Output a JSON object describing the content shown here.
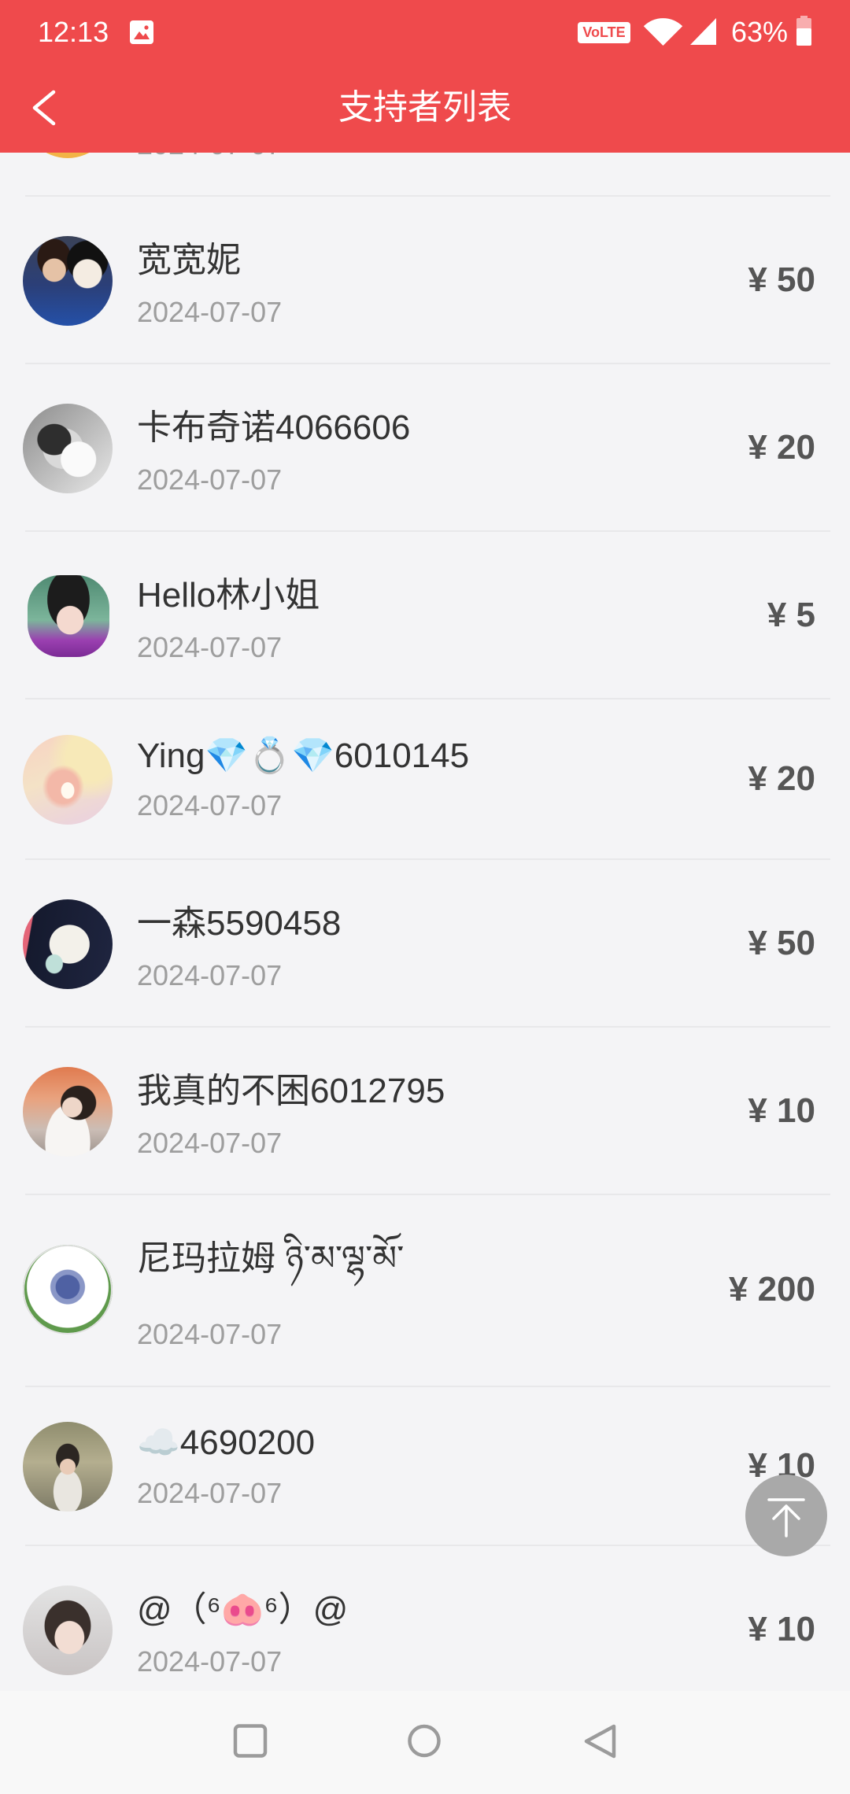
{
  "status_bar": {
    "time": "12:13",
    "network_badge": "VoLTE",
    "battery_text": "63%",
    "battery_level": 0.63,
    "icons": {
      "notification": "gallery-icon",
      "wifi": "wifi-icon",
      "signal": "signal-icon",
      "battery": "battery-icon"
    }
  },
  "header": {
    "title": "支持者列表",
    "back_icon": "chevron-left-icon"
  },
  "supporters": [
    {
      "date": "2024-07-07"
    },
    {
      "name": "宽宽妮",
      "date": "2024-07-07",
      "amount": "¥ 50"
    },
    {
      "name": "卡布奇诺4066606",
      "date": "2024-07-07",
      "amount": "¥ 20"
    },
    {
      "name": "Hello林小姐",
      "date": "2024-07-07",
      "amount": "¥ 5"
    },
    {
      "name": "Ying💎💍💎6010145",
      "date": "2024-07-07",
      "amount": "¥ 20"
    },
    {
      "name": "一森5590458",
      "date": "2024-07-07",
      "amount": "¥ 50"
    },
    {
      "name": "我真的不困6012795",
      "date": "2024-07-07",
      "amount": "¥ 10"
    },
    {
      "name": "尼玛拉姆 ཉི་མ་ལྷ་མོ་",
      "date": "2024-07-07",
      "amount": "¥ 200"
    },
    {
      "name": "☁️4690200",
      "date": "2024-07-07",
      "amount": "¥ 10"
    },
    {
      "name": "@（⁶🐽⁶）@",
      "date": "2024-07-07",
      "amount": "¥ 10"
    }
  ],
  "scroll_top_button": {
    "icon": "arrow-to-top-icon"
  },
  "nav_bar": {
    "recents_icon": "square-icon",
    "home_icon": "circle-icon",
    "back_icon": "triangle-back-icon"
  },
  "colors": {
    "accent": "#EF4A4C",
    "background": "#F4F4F6",
    "name_text": "#333333",
    "date_text": "#9E9E9E",
    "amount_text": "#555555",
    "scroll_top_button": "#A9A9A9",
    "nav_bar": "#F8F8F8"
  }
}
